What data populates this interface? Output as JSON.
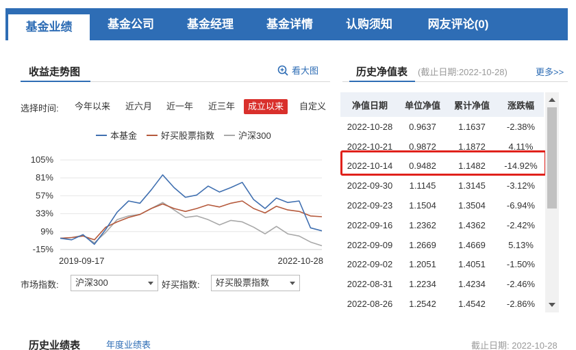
{
  "tabs": [
    "基金业绩",
    "基金公司",
    "基金经理",
    "基金详情",
    "认购须知",
    "网友评论(0)"
  ],
  "left": {
    "title": "收益走势图",
    "big_view": "看大图",
    "time_label": "选择时间:",
    "time_options": [
      "今年以来",
      "近六月",
      "近一年",
      "近三年",
      "成立以来",
      "自定义"
    ],
    "time_selected": "成立以来",
    "market_label": "市场指数:",
    "market_value": "沪深300",
    "haomai_label": "好买指数:",
    "haomai_value": "好买股票指数"
  },
  "right": {
    "title": "历史净值表",
    "date_info": "(截止日期:2022-10-28)",
    "more": "更多>>",
    "headers": [
      "净值日期",
      "单位净值",
      "累计净值",
      "涨跌幅"
    ],
    "rows": [
      [
        "2022-10-28",
        "0.9637",
        "1.1637",
        "-2.38%"
      ],
      [
        "2022-10-21",
        "0.9872",
        "1.1872",
        "4.11%"
      ],
      [
        "2022-10-14",
        "0.9482",
        "1.1482",
        "-14.92%"
      ],
      [
        "2022-09-30",
        "1.1145",
        "1.3145",
        "-3.12%"
      ],
      [
        "2022-09-23",
        "1.1504",
        "1.3504",
        "-6.94%"
      ],
      [
        "2022-09-16",
        "1.2362",
        "1.4362",
        "-2.42%"
      ],
      [
        "2022-09-09",
        "1.2669",
        "1.4669",
        "5.13%"
      ],
      [
        "2022-09-02",
        "1.2051",
        "1.4051",
        "-1.50%"
      ],
      [
        "2022-08-31",
        "1.2234",
        "1.4234",
        "-2.46%"
      ],
      [
        "2022-08-26",
        "1.2542",
        "1.4542",
        "-2.86%"
      ]
    ],
    "highlighted_row": "2022-10-14"
  },
  "bottom": {
    "title": "历史业绩表",
    "link": "年度业绩表",
    "date": "截止日期: 2022-10-28"
  },
  "colors": {
    "brand_blue": "#2e6db5",
    "active_red": "#d9302c",
    "up": "#e4393c",
    "down": "#2e9e3f",
    "series_fund": "#3f6fb0",
    "series_haomai": "#b5593b",
    "series_hs300": "#a8a8a8"
  },
  "chart_data": {
    "type": "line",
    "legend": [
      "本基金",
      "好买股票指数",
      "沪深300"
    ],
    "y_ticks": [
      "105%",
      "81%",
      "57%",
      "33%",
      "9%",
      "-15%"
    ],
    "ylim": [
      -15,
      105
    ],
    "x_tick_labels": [
      "2019-09-17",
      "2022-10-28"
    ],
    "x": [
      "2019-09-17",
      "2019-11",
      "2020-01",
      "2020-03",
      "2020-05",
      "2020-07",
      "2020-08",
      "2020-10",
      "2020-12",
      "2021-01",
      "2021-02",
      "2021-03",
      "2021-05",
      "2021-07",
      "2021-09",
      "2021-11",
      "2022-01",
      "2022-03",
      "2022-04",
      "2022-06",
      "2022-08",
      "2022-09",
      "2022-10-14",
      "2022-10-28"
    ],
    "series": [
      {
        "name": "本基金",
        "values": [
          0,
          -2,
          5,
          -8,
          12,
          35,
          50,
          47,
          65,
          85,
          68,
          55,
          58,
          70,
          62,
          68,
          75,
          52,
          40,
          54,
          48,
          50,
          14,
          10
        ]
      },
      {
        "name": "好买股票指数",
        "values": [
          0,
          1,
          3,
          -2,
          15,
          22,
          28,
          32,
          40,
          46,
          40,
          36,
          40,
          45,
          42,
          47,
          50,
          40,
          34,
          43,
          38,
          36,
          30,
          29
        ]
      },
      {
        "name": "沪深300",
        "values": [
          0,
          1,
          4,
          -6,
          8,
          25,
          30,
          32,
          40,
          48,
          38,
          28,
          30,
          25,
          18,
          24,
          22,
          15,
          6,
          16,
          6,
          3,
          -5,
          -10
        ]
      }
    ]
  }
}
